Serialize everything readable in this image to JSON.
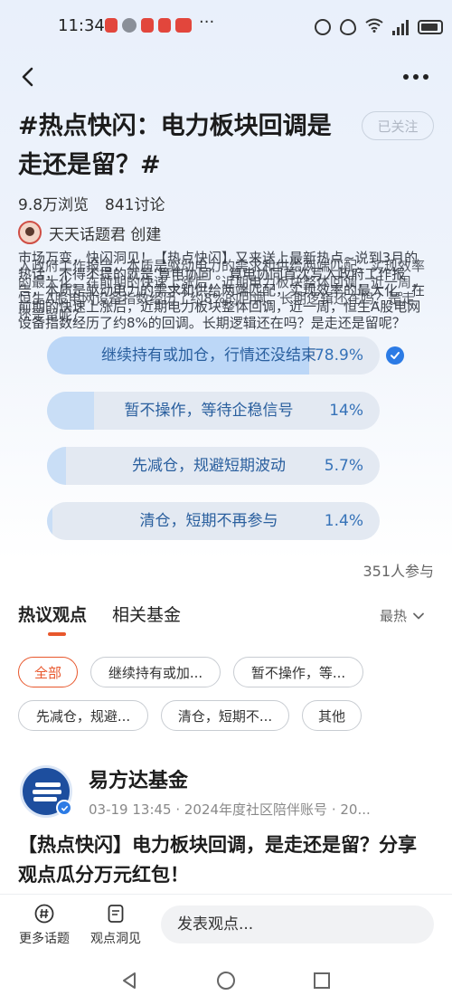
{
  "status_bar": {
    "time": "11:34",
    "more": "···",
    "network_label": "4G"
  },
  "nav": {
    "back_icon": "chevron-left-icon",
    "more_icon": "more-dots-icon"
  },
  "topic": {
    "title": "#热点快闪：电力板块回调是走还是留？#",
    "follow_label": "已关注",
    "views": "9.8万浏览",
    "discussions": "841讨论",
    "creator": "天天话题君 创建",
    "description_a": "市场万变，快闪洞见！【热点快闪】又来送上最新热点~说到3月的热话，不得不提的就是'算电协同'。算电协同首次写入政府工作报告，本质是驱动电力的需求和供给两端匹配，实现效率的最大化。在前期的快速上涨后，近期电力板块整体回调，近一周，恒生A股电网设备指数经历了约8%的回调。长期逻辑还在吗？是走还是留呢？",
    "description_b": "入政府工作报告，本质是驱动电力的需求和供给两端匹配，实现效率的最大化。在前期的快速上涨后，近期电力板块整体回调，近一周，恒生A股电网设备指数经历了约8%的回调。长期逻辑还在吗？是走还是留呢？"
  },
  "poll": {
    "options": [
      {
        "label": "继续持有或加仓，行情还没结束",
        "percent_text": "78.9%",
        "percent": 78.9,
        "selected": true
      },
      {
        "label": "暂不操作，等待企稳信号",
        "percent_text": "14%",
        "percent": 14,
        "selected": false
      },
      {
        "label": "先减仓，规避短期波动",
        "percent_text": "5.7%",
        "percent": 5.7,
        "selected": false
      },
      {
        "label": "清仓，短期不再参与",
        "percent_text": "1.4%",
        "percent": 1.4,
        "selected": false
      }
    ],
    "participants": "351人参与"
  },
  "tabs": {
    "items": [
      "热议观点",
      "相关基金"
    ],
    "active_index": 0,
    "sort_label": "最热"
  },
  "filters": {
    "chips": [
      "全部",
      "继续持有或加...",
      "暂不操作，等...",
      "先减仓，规避...",
      "清仓，短期不...",
      "其他"
    ],
    "active_index": 0
  },
  "post": {
    "author": "易方达基金",
    "meta": "03-19 13:45 · 2024年度社区陪伴账号 · 20...",
    "title": "【热点快闪】电力板块回调，是走还是留？分享观点瓜分万元红包！"
  },
  "bottom_bar": {
    "more_topics": "更多话题",
    "insights": "观点洞见",
    "comment_placeholder": "发表观点..."
  },
  "colors": {
    "accent": "#e8572c",
    "poll_text": "#2a5f9e",
    "check": "#2c7be5"
  }
}
